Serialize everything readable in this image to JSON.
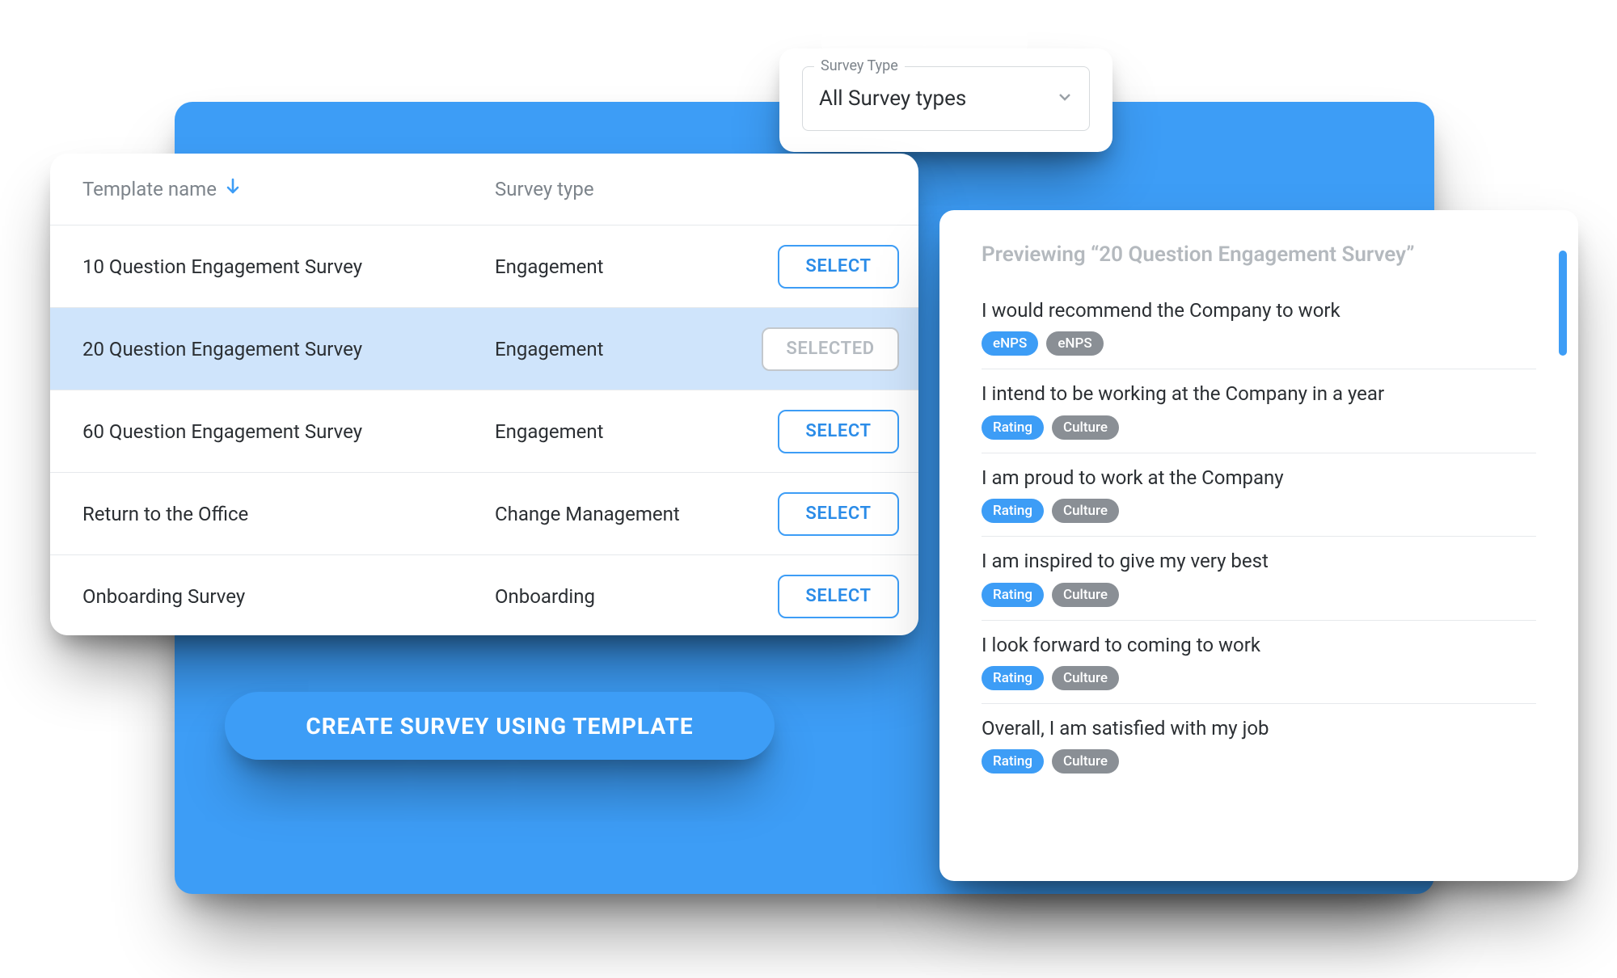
{
  "dropdown": {
    "legend": "Survey Type",
    "value": "All Survey types"
  },
  "table": {
    "headers": {
      "name": "Template name",
      "type": "Survey type"
    },
    "select_label": "SELECT",
    "selected_label": "SELECTED",
    "rows": [
      {
        "name": "10 Question Engagement Survey",
        "type": "Engagement",
        "selected": false
      },
      {
        "name": "20 Question Engagement Survey",
        "type": "Engagement",
        "selected": true
      },
      {
        "name": "60 Question Engagement Survey",
        "type": "Engagement",
        "selected": false
      },
      {
        "name": "Return to the Office",
        "type": "Change Management",
        "selected": false
      },
      {
        "name": "Onboarding Survey",
        "type": "Onboarding",
        "selected": false
      }
    ]
  },
  "cta": {
    "label": "CREATE SURVEY USING TEMPLATE"
  },
  "preview": {
    "title": "Previewing “20 Question Engagement Survey”",
    "questions": [
      {
        "text": "I would recommend the Company to work",
        "tags": [
          {
            "t": "eNPS",
            "c": "blue"
          },
          {
            "t": "eNPS",
            "c": "grey"
          }
        ]
      },
      {
        "text": "I intend to be working at the Company in a year",
        "tags": [
          {
            "t": "Rating",
            "c": "blue"
          },
          {
            "t": "Culture",
            "c": "grey"
          }
        ]
      },
      {
        "text": "I am proud to work at the Company",
        "tags": [
          {
            "t": "Rating",
            "c": "blue"
          },
          {
            "t": "Culture",
            "c": "grey"
          }
        ]
      },
      {
        "text": "I am inspired to give my very best",
        "tags": [
          {
            "t": "Rating",
            "c": "blue"
          },
          {
            "t": "Culture",
            "c": "grey"
          }
        ]
      },
      {
        "text": "I look forward to coming to work",
        "tags": [
          {
            "t": "Rating",
            "c": "blue"
          },
          {
            "t": "Culture",
            "c": "grey"
          }
        ]
      },
      {
        "text": "Overall, I am satisfied with my job",
        "tags": [
          {
            "t": "Rating",
            "c": "blue"
          },
          {
            "t": "Culture",
            "c": "grey"
          }
        ]
      }
    ]
  }
}
